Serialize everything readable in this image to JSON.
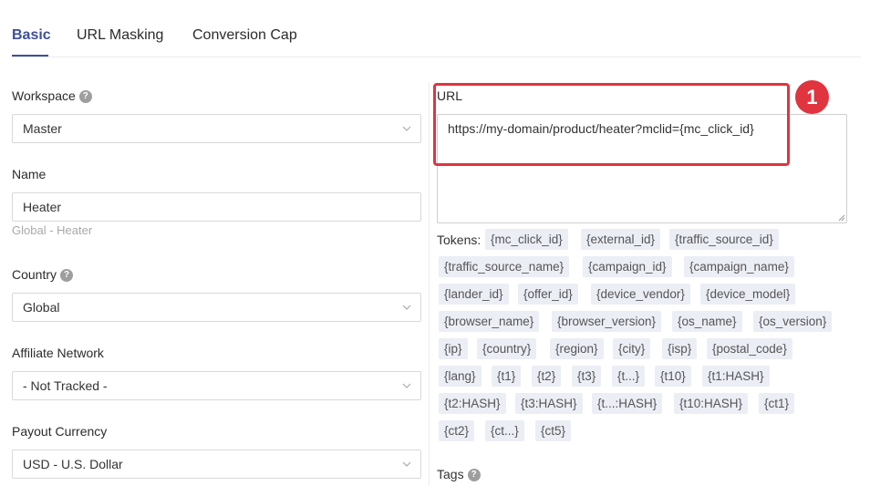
{
  "tabs": [
    {
      "label": "Basic",
      "active": true
    },
    {
      "label": "URL Masking",
      "active": false
    },
    {
      "label": "Conversion Cap",
      "active": false
    }
  ],
  "form": {
    "workspace": {
      "label": "Workspace",
      "value": "Master"
    },
    "name": {
      "label": "Name",
      "value": "Heater",
      "hint": "Global - Heater"
    },
    "country": {
      "label": "Country",
      "value": "Global"
    },
    "affiliate_network": {
      "label": "Affiliate Network",
      "value": "- Not Tracked -"
    },
    "payout_currency": {
      "label": "Payout Currency",
      "value": "USD - U.S. Dollar"
    }
  },
  "url": {
    "label": "URL",
    "value": "https://my-domain/product/heater?mclid={mc_click_id}"
  },
  "annotation": {
    "badge": "1",
    "color": "#e0343f"
  },
  "tokens": {
    "label": "Tokens:",
    "items": [
      "{mc_click_id}",
      "{external_id}",
      "{traffic_source_id}",
      "{traffic_source_name}",
      "{campaign_id}",
      "{campaign_name}",
      "{lander_id}",
      "{offer_id}",
      "{device_vendor}",
      "{device_model}",
      "{browser_name}",
      "{browser_version}",
      "{os_name}",
      "{os_version}",
      "{ip}",
      "{country}",
      "{region}",
      "{city}",
      "{isp}",
      "{postal_code}",
      "{lang}",
      "{t1}",
      "{t2}",
      "{t3}",
      "{t...}",
      "{t10}",
      "{t1:HASH}",
      "{t2:HASH}",
      "{t3:HASH}",
      "{t...:HASH}",
      "{t10:HASH}",
      "{ct1}",
      "{ct2}",
      "{ct...}",
      "{ct5}"
    ]
  },
  "tags": {
    "label": "Tags"
  },
  "colors": {
    "accent": "#3d4f9f",
    "highlight": "#e0343f",
    "token_bg": "#eceef6"
  },
  "icons": {
    "help": "question-circle-icon",
    "dropdown": "chevron-down-icon"
  }
}
